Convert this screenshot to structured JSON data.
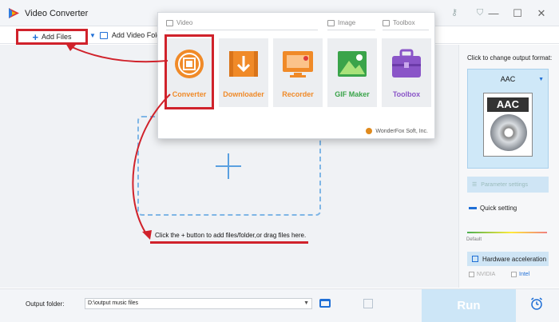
{
  "app": {
    "title": "Video Converter",
    "icon": "wonderfox-logo-icon"
  },
  "window": {
    "minimize": "—",
    "maximize": "☐",
    "close": "✕"
  },
  "toolbar": {
    "add_files": "Add Files",
    "add_video_folder": "Add Video Fold"
  },
  "popup": {
    "categories": [
      {
        "label": "Video",
        "icon": "video-icon"
      },
      {
        "label": "Image",
        "icon": "image-icon"
      },
      {
        "label": "Toolbox",
        "icon": "toolbox-icon"
      }
    ],
    "tiles": [
      {
        "label": "Converter",
        "icon": "film-reel-icon",
        "color": "#f08a28"
      },
      {
        "label": "Downloader",
        "icon": "download-icon",
        "color": "#f08a28"
      },
      {
        "label": "Recorder",
        "icon": "screen-record-icon",
        "color": "#f08a28"
      },
      {
        "label": "GIF Maker",
        "icon": "gif-image-icon",
        "color": "#3aa44a"
      },
      {
        "label": "Toolbox",
        "icon": "toolbox-icon",
        "color": "#8a55c8"
      }
    ],
    "brand": "WonderFox Soft, Inc."
  },
  "main": {
    "hint": "Click the + button to add files/folder,or drag files here."
  },
  "right": {
    "change_format": "Click to change output format:",
    "format": "AAC",
    "format_badge": "AAC",
    "parameter_settings": "Parameter settings",
    "quick_setting": "Quick setting",
    "slider_default": "Default",
    "hardware_acceleration": "Hardware acceleration",
    "vendors": [
      "NVIDIA",
      "Intel"
    ]
  },
  "bottom": {
    "output_folder_label": "Output folder:",
    "output_folder_value": "D:\\output music files",
    "run": "Run"
  },
  "colors": {
    "accent": "#1f6fd6",
    "annotation": "#d0222b",
    "run_bg": "#cde6f7"
  }
}
